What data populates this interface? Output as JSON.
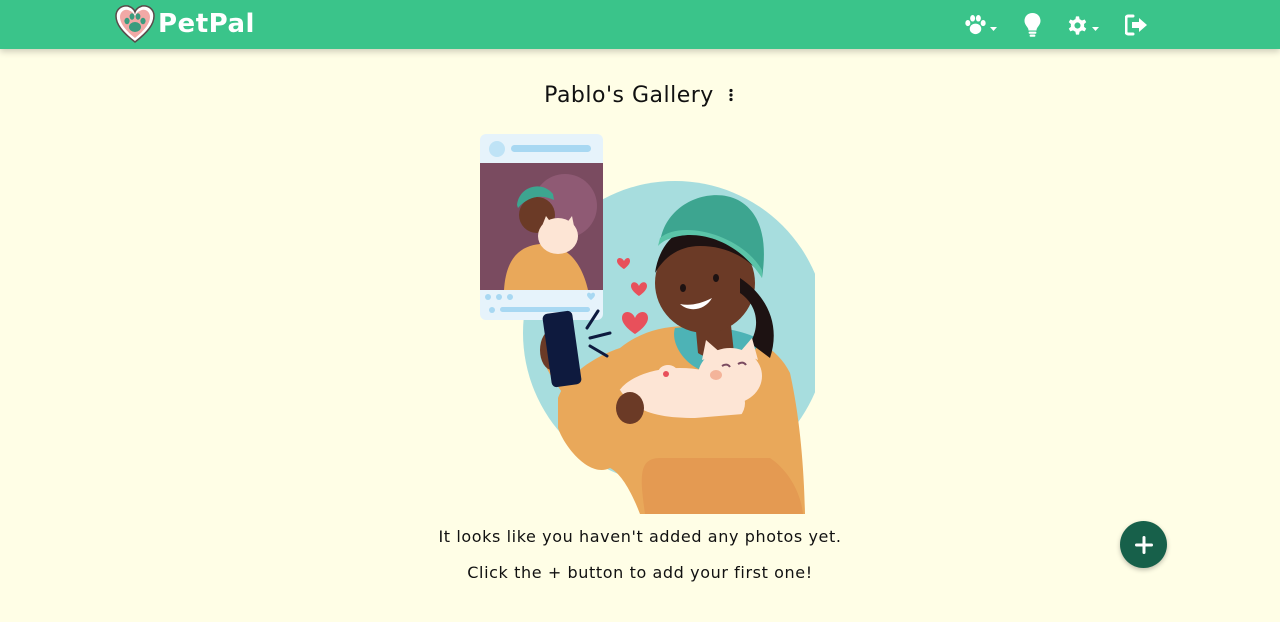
{
  "app": {
    "brand_name": "PetPal",
    "accent_color": "#3ac48a",
    "background_color": "#fffee6",
    "fab_color": "#17604a"
  },
  "navbar": {
    "icons": [
      {
        "name": "paw-icon",
        "has_dropdown": true
      },
      {
        "name": "lightbulb-icon",
        "has_dropdown": false
      },
      {
        "name": "gear-icon",
        "has_dropdown": true
      },
      {
        "name": "sign-out-icon",
        "has_dropdown": false
      }
    ]
  },
  "gallery": {
    "title": "Pablo's Gallery",
    "menu_icon": "vertical-ellipsis-icon",
    "empty_message_line1": "It looks like you haven't added any photos yet.",
    "empty_message_line2": "Click the + button to add your first one!"
  },
  "add_button": {
    "icon": "plus-icon"
  }
}
